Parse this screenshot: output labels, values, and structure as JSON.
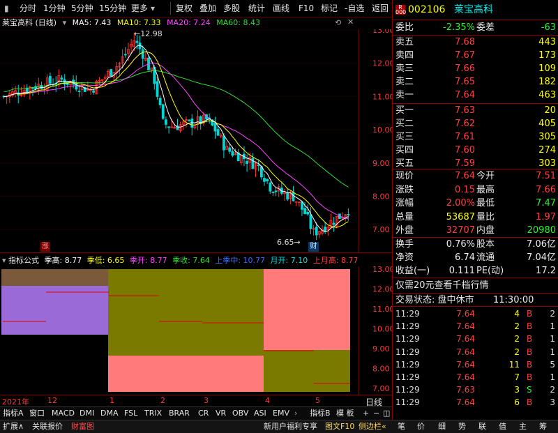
{
  "toolbar": {
    "items": [
      "分时",
      "1分钟",
      "5分钟",
      "15分钟",
      "更多",
      "复权",
      "叠加",
      "多股",
      "统计",
      "画线",
      "F10",
      "标记",
      "-自选",
      "返回"
    ]
  },
  "main_chart": {
    "stock_label": "莱宝高科 (日线)",
    "ma": [
      {
        "label": "MA5: 7.43",
        "color": "#ffffff"
      },
      {
        "label": "MA10: 7.33",
        "color": "#ffff00"
      },
      {
        "label": "MA20: 7.24",
        "color": "#ff44ff"
      },
      {
        "label": "MA60: 8.43",
        "color": "#33dd33"
      }
    ],
    "high_marker": "12.98",
    "low_marker": "6.65",
    "zhang_badge": "涨",
    "cai_badge": "财",
    "y_ticks": [
      "13.00",
      "12.00",
      "11.00",
      "10.00",
      "9.00",
      "8.00",
      "7.00"
    ]
  },
  "indicator": {
    "title": "指标公式",
    "items": [
      {
        "label": "季高: 8.77",
        "color": "#ffffff"
      },
      {
        "label": "季低: 6.65",
        "color": "#ffff00"
      },
      {
        "label": "季开: 8.77",
        "color": "#ff44ff"
      },
      {
        "label": "季收: 7.64",
        "color": "#33dd33"
      },
      {
        "label": "上季中: 10.77",
        "color": "#3a6bff"
      },
      {
        "label": "月开: 7.10",
        "color": "#00e5e5"
      },
      {
        "label": "上月高: 8.77",
        "color": "#ff4040"
      }
    ],
    "y_ticks": [
      "13.00",
      "12.00",
      "11.00",
      "10.00",
      "9.00",
      "8.00",
      "7.00"
    ]
  },
  "time_axis": [
    "2021年",
    "12",
    "1",
    "2",
    "3",
    "4",
    "5"
  ],
  "period_label": "日线",
  "indicator_tabs": [
    "指标A",
    "窗口",
    "MACD",
    "DMI",
    "DMA",
    "FSL",
    "TRIX",
    "BRAR",
    "CR",
    "VR",
    "OBV",
    "ASI",
    "EMV",
    "›",
    "指标B",
    "模 板",
    "+",
    "−",
    "◫"
  ],
  "status_bar": {
    "left": [
      "扩展∧",
      "关联报价",
      "财富图"
    ],
    "mid": [
      "新用户福利专享",
      "图文F10",
      "侧边栏«"
    ],
    "right_tabs": [
      "笔",
      "价",
      "细",
      "势",
      "联",
      "值",
      "主",
      "筹"
    ]
  },
  "quote": {
    "code": "002106",
    "name": "莱宝高科",
    "weibi_label": "委比",
    "weibi": "-2.35%",
    "weicha_label": "委差",
    "weicha": "-63",
    "sell": [
      {
        "label": "卖五",
        "price": "7.68",
        "vol": "443"
      },
      {
        "label": "卖四",
        "price": "7.67",
        "vol": "173"
      },
      {
        "label": "卖三",
        "price": "7.66",
        "vol": "109"
      },
      {
        "label": "卖二",
        "price": "7.65",
        "vol": "182"
      },
      {
        "label": "卖一",
        "price": "7.64",
        "vol": "463"
      }
    ],
    "buy": [
      {
        "label": "买一",
        "price": "7.63",
        "vol": "20"
      },
      {
        "label": "买二",
        "price": "7.62",
        "vol": "405"
      },
      {
        "label": "买三",
        "price": "7.61",
        "vol": "305"
      },
      {
        "label": "买四",
        "price": "7.60",
        "vol": "274"
      },
      {
        "label": "买五",
        "price": "7.59",
        "vol": "303"
      }
    ],
    "stats": [
      {
        "l1": "现价",
        "v1": "7.64",
        "c1": "#ff4040",
        "l2": "今开",
        "v2": "7.51",
        "c2": "#ff4040"
      },
      {
        "l1": "涨跌",
        "v1": "0.15",
        "c1": "#ff4040",
        "l2": "最高",
        "v2": "7.66",
        "c2": "#ff4040"
      },
      {
        "l1": "涨幅",
        "v1": "2.00%",
        "c1": "#ff4040",
        "l2": "最低",
        "v2": "7.47",
        "c2": "#33ee33"
      },
      {
        "l1": "总量",
        "v1": "53687",
        "c1": "#ffff00",
        "l2": "量比",
        "v2": "1.97",
        "c2": "#ff4040"
      },
      {
        "l1": "外盘",
        "v1": "32707",
        "c1": "#ff4040",
        "l2": "内盘",
        "v2": "20980",
        "c2": "#33ee33"
      }
    ],
    "fund": [
      {
        "l1": "换手",
        "v1": "0.76%",
        "l2": "股本",
        "v2": "7.06亿"
      },
      {
        "l1": "净资",
        "v1": "6.74",
        "l2": "流通",
        "v2": "7.04亿"
      },
      {
        "l1": "收益(一)",
        "v1": "0.111",
        "l2": "PE(动)",
        "v2": "17.2"
      }
    ],
    "promo": "仅需20元查看千档行情",
    "trade_state": "交易状态: 盘中休市",
    "trade_time": "11:30:00",
    "ticks": [
      {
        "t": "11:29",
        "p": "7.64",
        "v": "4",
        "bs": "B",
        "n": "2"
      },
      {
        "t": "11:29",
        "p": "7.64",
        "v": "2",
        "bs": "B",
        "n": "1"
      },
      {
        "t": "11:29",
        "p": "7.64",
        "v": "2",
        "bs": "B",
        "n": "1"
      },
      {
        "t": "11:29",
        "p": "7.64",
        "v": "2",
        "bs": "B",
        "n": "1"
      },
      {
        "t": "11:29",
        "p": "7.64",
        "v": "11",
        "bs": "B",
        "n": "5"
      },
      {
        "t": "11:29",
        "p": "7.64",
        "v": "7",
        "bs": "B",
        "n": "1"
      },
      {
        "t": "11:29",
        "p": "7.63",
        "v": "3",
        "bs": "S",
        "n": "2"
      },
      {
        "t": "11:29",
        "p": "7.64",
        "v": "6",
        "bs": "B",
        "n": "3"
      }
    ]
  }
}
